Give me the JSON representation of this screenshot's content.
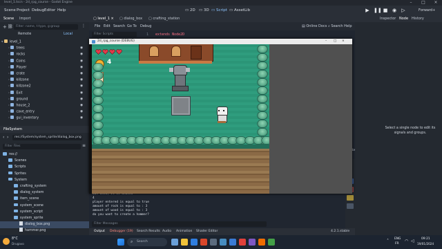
{
  "window": {
    "title": "level_1.tscn - 2d_rpg_course - Godot Engine"
  },
  "menu": {
    "items": [
      "Scene",
      "Project",
      "Debug",
      "Editor",
      "Help"
    ],
    "modes": [
      "2D",
      "3D",
      "Script",
      "AssetLib"
    ],
    "renderer": "Forward+"
  },
  "scene_dock": {
    "tabs": [
      "Scene",
      "Import"
    ],
    "filter_placeholder": "Filter: name, t:type, g:group",
    "remote_label": "Remote",
    "local_label": "Local",
    "nodes": [
      {
        "label": "level_1",
        "color": "#e5c07b"
      },
      {
        "label": "trees",
        "color": "#8fb4e0"
      },
      {
        "label": "rocks",
        "color": "#8fb4e0"
      },
      {
        "label": "Coins",
        "color": "#8fb4e0"
      },
      {
        "label": "Player",
        "color": "#8fb4e0"
      },
      {
        "label": "crate",
        "color": "#8fb4e0"
      },
      {
        "label": "killzone",
        "color": "#8fb4e0"
      },
      {
        "label": "killzone2",
        "color": "#8fb4e0"
      },
      {
        "label": "Exit",
        "color": "#8fb4e0"
      },
      {
        "label": "ground",
        "color": "#8fb4e0"
      },
      {
        "label": "house_2",
        "color": "#8fb4e0"
      },
      {
        "label": "cave_entry",
        "color": "#8fb4e0"
      },
      {
        "label": "gui_inventory",
        "color": "#8fb4e0"
      }
    ]
  },
  "filesystem": {
    "title": "FileSystem",
    "path": "res://System/system_sprite/dialog_box.png",
    "filter_placeholder": "Filter Files",
    "items": [
      {
        "label": "res://",
        "kind": "folder",
        "indent": 0
      },
      {
        "label": "Scenes",
        "kind": "folder",
        "indent": 1
      },
      {
        "label": "Scripts",
        "kind": "folder",
        "indent": 1
      },
      {
        "label": "Sprites",
        "kind": "folder",
        "indent": 1
      },
      {
        "label": "System",
        "kind": "folder",
        "indent": 1
      },
      {
        "label": "crafting_system",
        "kind": "folder",
        "indent": 2
      },
      {
        "label": "dialog_system",
        "kind": "folder",
        "indent": 2
      },
      {
        "label": "item_scene",
        "kind": "folder",
        "indent": 2
      },
      {
        "label": "system_scene",
        "kind": "folder",
        "indent": 2
      },
      {
        "label": "system_script",
        "kind": "folder",
        "indent": 2
      },
      {
        "label": "system_sprite",
        "kind": "folder",
        "indent": 2
      },
      {
        "label": "dialog_box.png",
        "kind": "file",
        "indent": 3
      },
      {
        "label": "hammer.png",
        "kind": "file",
        "indent": 3
      }
    ]
  },
  "script_editor": {
    "tabs": [
      "level_1",
      "dialog_box",
      "crafting_station"
    ],
    "menu": [
      "File",
      "Edit",
      "Search",
      "Go To",
      "Debug"
    ],
    "online_docs": "Online Docs",
    "search_help": "Search Help",
    "filter_placeholder": "Filter Scripts",
    "line_number": "1",
    "code_line": "extends Node2D",
    "line_col": "14",
    "tabs_label": "Tabs"
  },
  "game_window": {
    "title": "2d_rpg_course (DEBUG)",
    "coin_count": "4"
  },
  "output": {
    "lines": [
      "was used, it is unused",
      "4",
      "player entered is equal to true",
      "amount of rock is equal to : 3",
      "amount of wood is equal to : 3",
      "do you want to create a hammer?"
    ],
    "filter_placeholder": "Filter Messages",
    "bottom_tabs": [
      "Output",
      "Debugger (19)",
      "Search Results",
      "Audio",
      "Animation",
      "Shader Editor"
    ],
    "version": "4.2.1.stable"
  },
  "inspector": {
    "tabs": [
      "Inspector",
      "Node",
      "History"
    ],
    "message": "Select a single node to edit its signals and groups."
  },
  "taskbar": {
    "weather_temp": "8°C",
    "weather_desc": "Drugavo",
    "search_placeholder": "Search",
    "lang": "ENG",
    "region": "FR",
    "time": "09:21",
    "date": "19/01/2024"
  }
}
